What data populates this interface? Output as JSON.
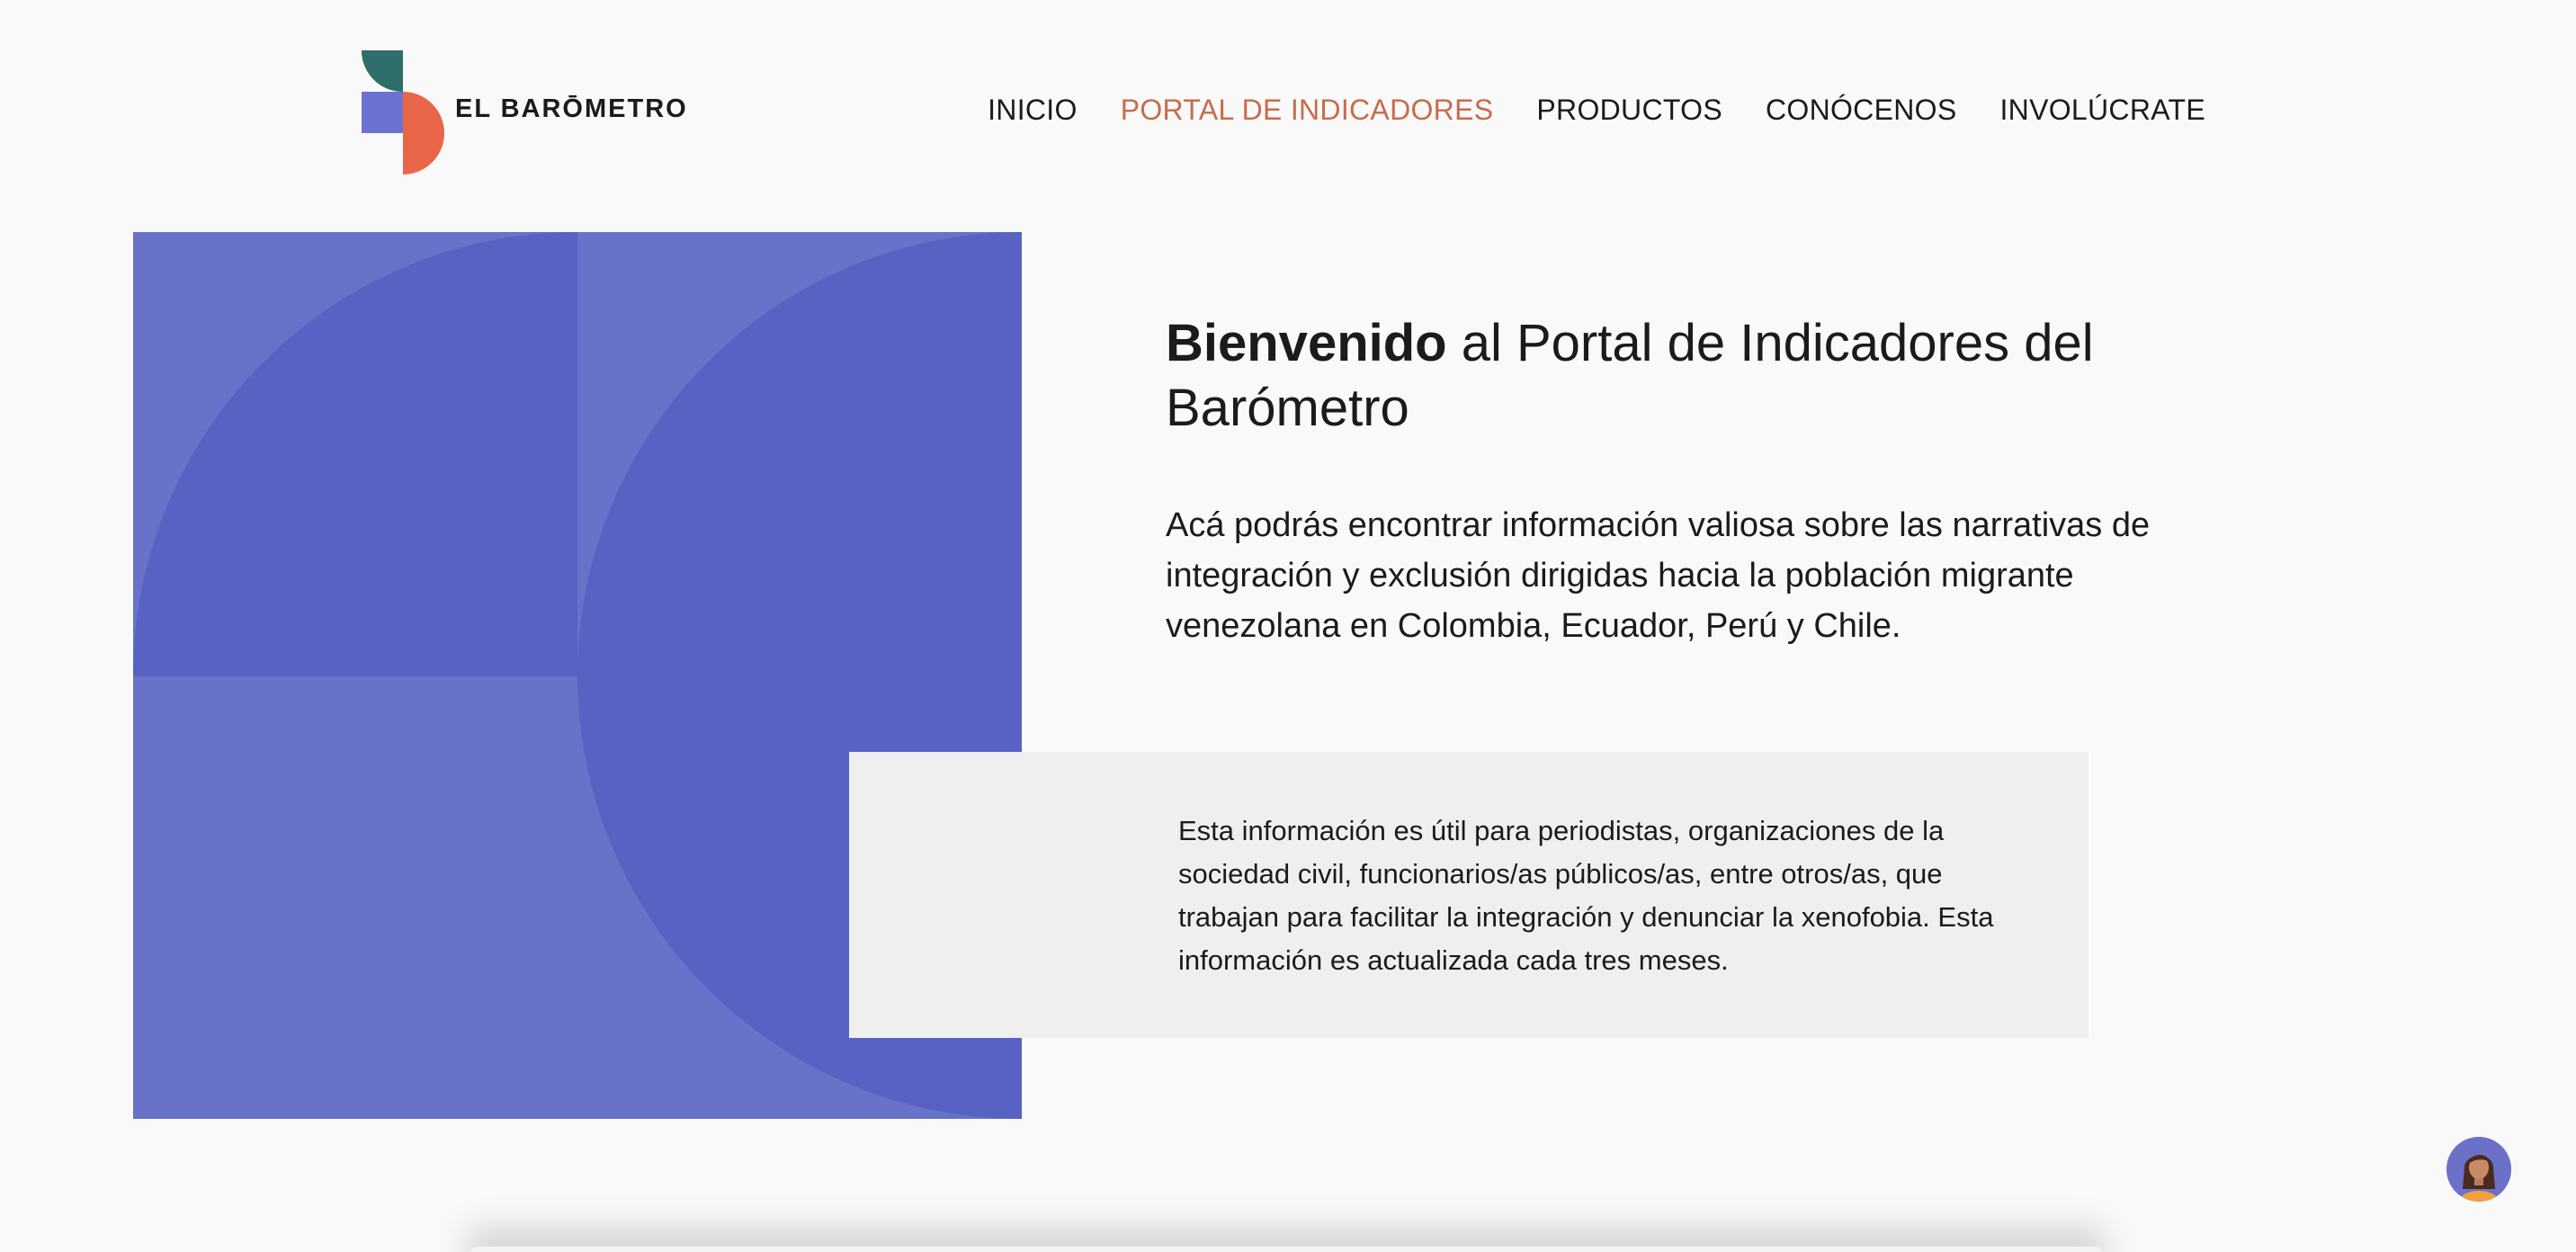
{
  "header": {
    "logo_text": "EL BARŌMETRO",
    "nav": [
      {
        "label": "INICIO",
        "active": false
      },
      {
        "label": "PORTAL DE INDICADORES",
        "active": true
      },
      {
        "label": "PRODUCTOS",
        "active": false
      },
      {
        "label": "CONÓCENOS",
        "active": false
      },
      {
        "label": "INVOLÚCRATE",
        "active": false
      }
    ]
  },
  "hero": {
    "title_bold": "Bienvenido",
    "title_rest": " al Portal de Indicadores del Barómetro",
    "subtitle": "Acá podrás encontrar información valiosa sobre las narrativas de integración y exclusión dirigidas hacia la población migrante venezolana en Colombia, Ecuador, Perú y Chile."
  },
  "info_box": {
    "text": "Esta información es útil para periodistas, organizaciones de la sociedad civil, funcionarios/as públicos/as, entre otros/as, que trabajan para facilitar la integración y denunciar la xenofobia. Esta información es actualizada cada tres meses."
  },
  "icons": {
    "logo": "barometro-logo-icon",
    "chat": "chat-avatar-icon"
  },
  "colors": {
    "background": "#f9f9f9",
    "accent_active_nav": "#c86c4c",
    "art_light": "#6772c8",
    "art_dark": "#5762c3",
    "logo_teal": "#2e6e6b",
    "logo_blue": "#6b72cf",
    "logo_orange": "#e8654a",
    "info_box_bg": "#efefef"
  }
}
